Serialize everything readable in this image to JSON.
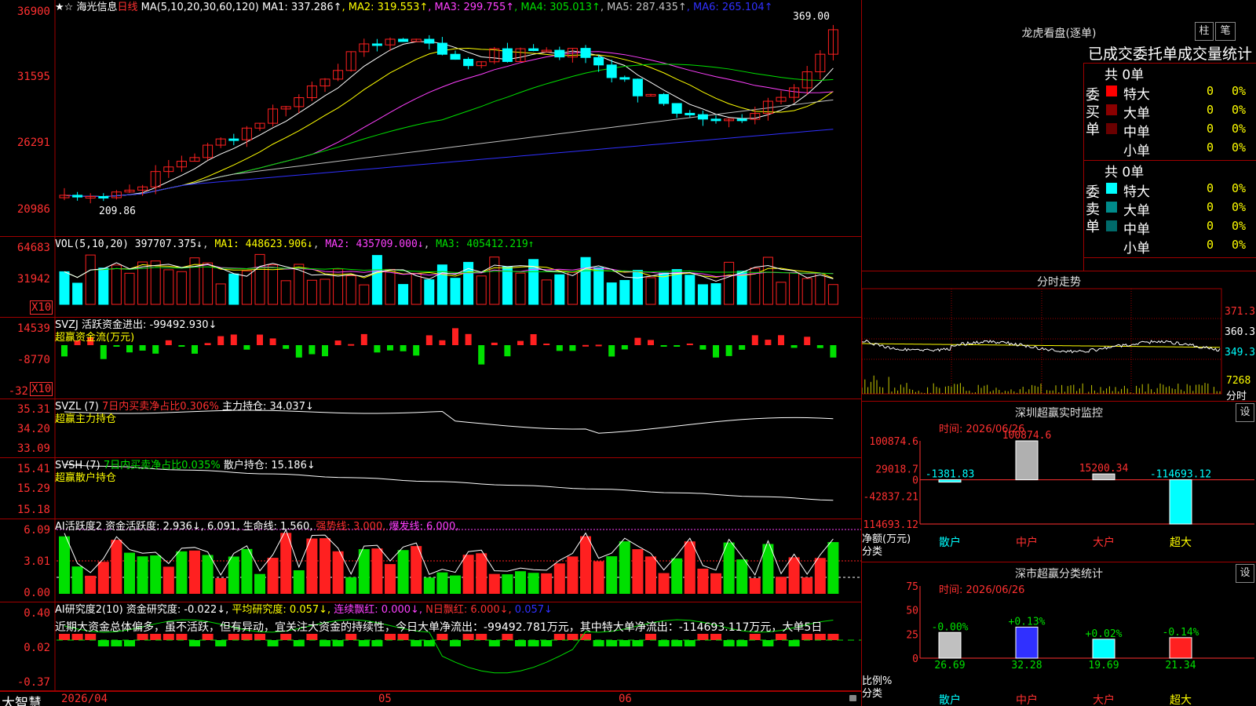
{
  "app": {
    "brand": "大智慧"
  },
  "kline": {
    "stock": "海光信息",
    "period": "日线",
    "ma_formula": "MA(5,10,20,30,60,120)",
    "ma_values": [
      {
        "label": "MA1: 337.286↑",
        "color": "#ffffff"
      },
      {
        "label": "MA2: 319.553↑",
        "color": "#ffff00"
      },
      {
        "label": "MA3: 299.755↑",
        "color": "#ff40ff"
      },
      {
        "label": "MA4: 305.013↑",
        "color": "#00e000"
      },
      {
        "label": "MA5: 287.435↑",
        "color": "#c0c0c0"
      },
      {
        "label": "MA6: 265.104↑",
        "color": "#3030ff"
      }
    ],
    "yticks": [
      "36900",
      "31595",
      "26291",
      "20986"
    ],
    "high_label": "369.00",
    "low_label": "209.86",
    "xlabels": [
      "2026/04",
      "05",
      "06"
    ]
  },
  "vol": {
    "header": "VOL(5,10,20) ",
    "value": "397707.375↓",
    "ma1": "MA1: 448623.906↓",
    "ma2": "MA2: 435709.000↓",
    "ma3": "MA3: 405412.219↑",
    "yticks": [
      "64683",
      "31942"
    ],
    "unit": "X10"
  },
  "svzj": {
    "header": "SVZJ  活跃资金进出: -99492.930↓",
    "sub": "超赢资金流(万元)",
    "yticks": [
      "14539",
      "-8770",
      "-32"
    ],
    "unit": "X10"
  },
  "svzl": {
    "header": "SVZL (7)",
    "pct": "7日内买卖净占比0.306%",
    "hold": " 主力持仓: 34.037↓",
    "sub": "超赢主力持仓",
    "yticks": [
      "35.31",
      "34.20",
      "33.09"
    ]
  },
  "svsh": {
    "header": "SVSH (7)",
    "pct": "7日内买卖净占比0.035%",
    "hold": " 散户持仓: 15.186↓",
    "sub": "超赢散户持仓",
    "yticks": [
      "15.41",
      "15.29",
      "15.18"
    ]
  },
  "ai2": {
    "header": "AI活跃度2 资金活跃度: 2.936↓, 6.091, 生命线: 1.560,",
    "strong": " 强势线: 3.000,",
    "burst": " 爆发线: 6.000,",
    "yticks": [
      "6.09",
      "3.01",
      "0.00"
    ]
  },
  "ai3": {
    "header": "AI研究度2(10) 资金研究度: -0.022↓,",
    "avg": " 平均研究度: 0.057↓,",
    "red1": " 连续飘红: 0.000↓,",
    "red2": " N日飘红: 6.000↓,",
    "last": " 0.057↓",
    "text": "近期大资金总体偏多，虽不活跃，但有异动，宜关注大资金的持续性，今日大单净流出：-99492.781万元，其中特大单净流出：-114693.117万元，大单5日",
    "yticks": [
      "0.40",
      "0.02",
      "-0.37"
    ]
  },
  "lhb": {
    "title": "龙虎看盘(逐单)",
    "btn1": "柱",
    "btn2": "笔",
    "tabs": "已成交委托单成交量统计",
    "buy": {
      "side": "委买单",
      "count": "共 0单",
      "rows": [
        {
          "name": "特大",
          "color": "#ff0000",
          "v": "0",
          "p": "0%"
        },
        {
          "name": "大单",
          "color": "#8b0000",
          "v": "0",
          "p": "0%"
        },
        {
          "name": "中单",
          "color": "#6a0000",
          "v": "0",
          "p": "0%"
        },
        {
          "name": "小单",
          "color": "#000000",
          "v": "0",
          "p": "0%"
        }
      ]
    },
    "sell": {
      "side": "委卖单",
      "count": "共 0单",
      "rows": [
        {
          "name": "特大",
          "color": "#00ffff",
          "v": "0",
          "p": "0%"
        },
        {
          "name": "大单",
          "color": "#008b8b",
          "v": "0",
          "p": "0%"
        },
        {
          "name": "中单",
          "color": "#006a6a",
          "v": "0",
          "p": "0%"
        },
        {
          "name": "小单",
          "color": "#000000",
          "v": "0",
          "p": "0%"
        }
      ]
    }
  },
  "fenshi": {
    "title": "分时走势",
    "yticks": [
      "371.3",
      "360.3",
      "349.3"
    ],
    "vol_label": "7268",
    "vol_unit": "分时"
  },
  "szmon": {
    "title": "深圳超赢实时监控",
    "btn": "设",
    "time": "时间: 2026/06/26",
    "yticks": [
      "100874.6",
      "29018.7",
      "0",
      "-42837.21",
      "-114693.12"
    ],
    "axis1": "净额(万元)",
    "axis2": "分类",
    "cats": [
      "散户",
      "中户",
      "大户",
      "超大"
    ],
    "labels": [
      "-1381.83",
      "100874.6",
      "15200.34",
      "-114693.12"
    ]
  },
  "szcls": {
    "title": "深市超赢分类统计",
    "btn": "设",
    "time": "时间: 2026/06/26",
    "yticks": [
      "75",
      "50",
      "25",
      "0"
    ],
    "axis1": "比例%",
    "axis2": "分类",
    "cats": [
      "散户",
      "中户",
      "大户",
      "超大"
    ],
    "top": [
      "-0.00%",
      "+0.13%",
      "+0.02%",
      "-0.14%"
    ],
    "bot": [
      "26.69",
      "32.28",
      "19.69",
      "21.34"
    ]
  },
  "chart_data": [
    {
      "type": "bar",
      "name": "monitor",
      "categories": [
        "散户",
        "中户",
        "大户",
        "超大"
      ],
      "values": [
        -1381.83,
        100874.6,
        15200.34,
        -114693.12
      ],
      "ylim": [
        -114693.12,
        100874.6
      ],
      "xlabel": "分类",
      "ylabel": "净额(万元)"
    },
    {
      "type": "bar",
      "name": "classification",
      "categories": [
        "散户",
        "中户",
        "大户",
        "超大"
      ],
      "values": [
        26.69,
        32.28,
        19.69,
        21.34
      ],
      "changes": [
        "-0.00%",
        "+0.13%",
        "+0.02%",
        "-0.14%"
      ],
      "ylim": [
        0,
        75
      ],
      "xlabel": "分类",
      "ylabel": "比例%"
    }
  ]
}
